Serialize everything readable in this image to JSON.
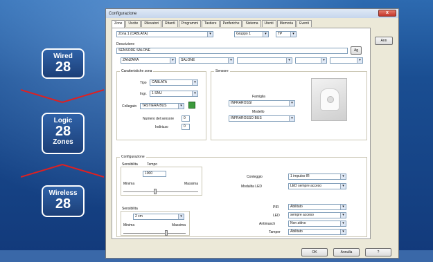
{
  "left_panel": {
    "wired": {
      "label": "Wired",
      "count": "28"
    },
    "logic": {
      "label": "Logic",
      "count": "28",
      "sub": "Zones"
    },
    "wireless": {
      "label": "Wireless",
      "count": "28"
    }
  },
  "window": {
    "title": "Configurazione",
    "close": "x",
    "tabs": [
      "Zone",
      "Uscite",
      "Rilevatori",
      "Ritardi",
      "Programmi",
      "Tastiere",
      "Periferiche",
      "Sistema",
      "Utenti",
      "Memoria",
      "Eventi"
    ],
    "top_combo1": "Zona 1 (CABLATA)",
    "top_combo2": "Gruppo 1",
    "top_combo3": "TP",
    "side_button": "Ann",
    "desc_label": "Descrizione",
    "desc_value": "SENSORE SALONE",
    "desc_button": "Ag",
    "areas": [
      "ZANZARA",
      "SALONE",
      "",
      "",
      ""
    ],
    "carat_title": "Caratteristiche zona",
    "tipo_label": "Tipo",
    "tipo_value": "CABLATA",
    "tipo2_label": "Ingr.",
    "tipo2_value": "1 SNU",
    "collegato_label": "Collegato",
    "collegato_value": "TASTIERA BUS",
    "numero_label": "Numero del sensore",
    "numero_value": "0",
    "indirizzo_label": "Indirizzo",
    "indirizzo_value": "0",
    "sensore_title": "Sensore",
    "famiglia_label": "Famiglia",
    "famiglia_value": "INFRAROSSI",
    "modello_label": "Modello",
    "modello_value": "INFRAROSSO BUS",
    "config_title": "Configurazione",
    "sens_label": "Sensibilita",
    "tempo_label": "Tempo",
    "tempo_value": "1000",
    "minima": "Minima",
    "massima": "Massima",
    "count_label": "Conteggio",
    "count_value": "1 impulso IR",
    "mod_label": "Modalita LED",
    "mod_value": "LED sempre acceso",
    "sens2_label": "Sensibilita",
    "sens2_value": "2 cm",
    "minima2": "Minima",
    "massima2": "Massima",
    "right_rows": [
      {
        "label": "PIR",
        "value": "Abilitato"
      },
      {
        "label": "LED",
        "value": "sempre acceso"
      },
      {
        "label": "Antimasch",
        "value": "Non attivo"
      },
      {
        "label": "Tamper",
        "value": "Abilitato"
      }
    ],
    "btn_ok": "OK",
    "btn_annulla": "Annulla",
    "btn_help": "?"
  }
}
